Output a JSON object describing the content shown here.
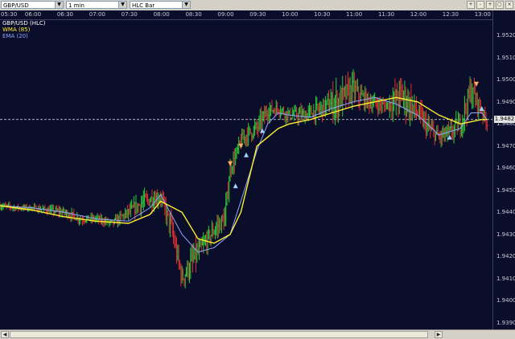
{
  "toolbar": {
    "symbol": "GBP/USD",
    "interval": "1 min",
    "chart_style": "HLC Bar",
    "buttons": [
      "zoom-in-icon",
      "zoom-out-icon",
      "crosshair-icon",
      "restore-icon",
      "close-icon"
    ],
    "button_glyphs": [
      "+",
      "-",
      "+",
      "▢",
      "×"
    ]
  },
  "legend": [
    {
      "text": "GBP/USD (HLC)",
      "color": "#ffffff"
    },
    {
      "text": "WMA (85)",
      "color": "#ffee33"
    },
    {
      "text": "EMA (20)",
      "color": "#8fa8ff"
    }
  ],
  "current_price": "1.9482",
  "colors": {
    "background": "#0a0e2a",
    "up_bar": "#2ecc3a",
    "down_bar": "#e03030",
    "wma": "#ffee33",
    "ema": "#8fa8ff",
    "arrow_up": "#9fd3ff",
    "arrow_down": "#ffb060"
  },
  "chart_data": {
    "type": "line",
    "x_ticks": [
      "05:30",
      "06:00",
      "06:30",
      "07:00",
      "07:30",
      "08:00",
      "08:30",
      "09:00",
      "09:30",
      "10:00",
      "10:30",
      "11:00",
      "11:30",
      "12:00",
      "12:30",
      "13:00"
    ],
    "y_ticks": [
      "1.9520",
      "1.9510",
      "1.9500",
      "1.9490",
      "1.9480",
      "1.9470",
      "1.9460",
      "1.9450",
      "1.9440",
      "1.9430",
      "1.9420",
      "1.9410",
      "1.9400",
      "1.9390"
    ],
    "ylim": [
      1.9387,
      1.9527
    ],
    "xlim": [
      "05:30",
      "13:10"
    ],
    "grid": false,
    "legend_position": "top-left",
    "series": [
      {
        "name": "GBP/USD (HLC)",
        "style": "hlc-bars",
        "x": [
          "05:30",
          "05:45",
          "06:00",
          "06:15",
          "06:30",
          "06:45",
          "07:00",
          "07:15",
          "07:30",
          "07:45",
          "08:00",
          "08:10",
          "08:20",
          "08:30",
          "08:40",
          "08:50",
          "09:00",
          "09:05",
          "09:10",
          "09:15",
          "09:20",
          "09:30",
          "09:40",
          "09:50",
          "10:00",
          "10:15",
          "10:30",
          "10:45",
          "11:00",
          "11:05",
          "11:15",
          "11:30",
          "11:45",
          "12:00",
          "12:10",
          "12:20",
          "12:30",
          "12:40",
          "12:50",
          "13:00",
          "13:05"
        ],
        "close": [
          1.9443,
          1.9442,
          1.9442,
          1.9441,
          1.944,
          1.9437,
          1.9437,
          1.9435,
          1.944,
          1.9445,
          1.9447,
          1.9433,
          1.941,
          1.9418,
          1.9425,
          1.9432,
          1.9437,
          1.946,
          1.9465,
          1.9472,
          1.9475,
          1.9478,
          1.9486,
          1.9487,
          1.9484,
          1.9484,
          1.9487,
          1.949,
          1.9496,
          1.9493,
          1.949,
          1.9488,
          1.9493,
          1.9485,
          1.9478,
          1.9474,
          1.9476,
          1.948,
          1.9495,
          1.9486,
          1.948
        ],
        "high": [
          1.9445,
          1.9444,
          1.9444,
          1.9443,
          1.9442,
          1.944,
          1.9439,
          1.9438,
          1.9444,
          1.9452,
          1.945,
          1.944,
          1.9418,
          1.9428,
          1.9432,
          1.944,
          1.9445,
          1.9465,
          1.9472,
          1.9478,
          1.948,
          1.9487,
          1.949,
          1.949,
          1.9489,
          1.949,
          1.9495,
          1.9505,
          1.9504,
          1.95,
          1.9495,
          1.9492,
          1.951,
          1.9492,
          1.9483,
          1.948,
          1.9482,
          1.9488,
          1.95,
          1.949,
          1.9484
        ],
        "low": [
          1.944,
          1.944,
          1.944,
          1.9438,
          1.9436,
          1.9434,
          1.9434,
          1.9432,
          1.9436,
          1.944,
          1.944,
          1.9425,
          1.9405,
          1.941,
          1.942,
          1.9428,
          1.943,
          1.9455,
          1.946,
          1.9466,
          1.947,
          1.9474,
          1.948,
          1.9482,
          1.948,
          1.948,
          1.9483,
          1.9484,
          1.9488,
          1.9486,
          1.9484,
          1.9484,
          1.9486,
          1.9476,
          1.9471,
          1.9469,
          1.947,
          1.9474,
          1.9482,
          1.948,
          1.9477
        ]
      },
      {
        "name": "WMA (85)",
        "style": "line",
        "x": [
          "05:30",
          "06:00",
          "06:30",
          "07:00",
          "07:30",
          "07:50",
          "08:00",
          "08:20",
          "08:35",
          "08:50",
          "09:05",
          "09:15",
          "09:30",
          "09:40",
          "09:50",
          "10:00",
          "10:20",
          "10:40",
          "11:00",
          "11:20",
          "11:40",
          "12:00",
          "12:20",
          "12:40",
          "13:00",
          "13:05"
        ],
        "y": [
          1.9443,
          1.9441,
          1.9438,
          1.9436,
          1.9435,
          1.9439,
          1.9445,
          1.944,
          1.9428,
          1.9426,
          1.943,
          1.944,
          1.947,
          1.9474,
          1.9478,
          1.948,
          1.9482,
          1.9485,
          1.9488,
          1.949,
          1.9492,
          1.949,
          1.9484,
          1.948,
          1.9482,
          1.9482
        ]
      },
      {
        "name": "EMA (20)",
        "style": "line",
        "x": [
          "05:30",
          "06:00",
          "06:30",
          "07:00",
          "07:30",
          "07:50",
          "08:00",
          "08:20",
          "08:35",
          "08:50",
          "09:05",
          "09:15",
          "09:30",
          "09:40",
          "09:50",
          "10:00",
          "10:20",
          "10:40",
          "11:00",
          "11:20",
          "11:40",
          "12:00",
          "12:20",
          "12:40",
          "12:50",
          "13:00",
          "13:05"
        ],
        "y": [
          1.9443,
          1.9442,
          1.944,
          1.9437,
          1.9436,
          1.9442,
          1.9448,
          1.943,
          1.9422,
          1.9424,
          1.943,
          1.9445,
          1.9468,
          1.948,
          1.9485,
          1.9484,
          1.9483,
          1.9487,
          1.949,
          1.9492,
          1.9489,
          1.9484,
          1.9475,
          1.9478,
          1.9485,
          1.9485,
          1.9482
        ]
      }
    ]
  }
}
